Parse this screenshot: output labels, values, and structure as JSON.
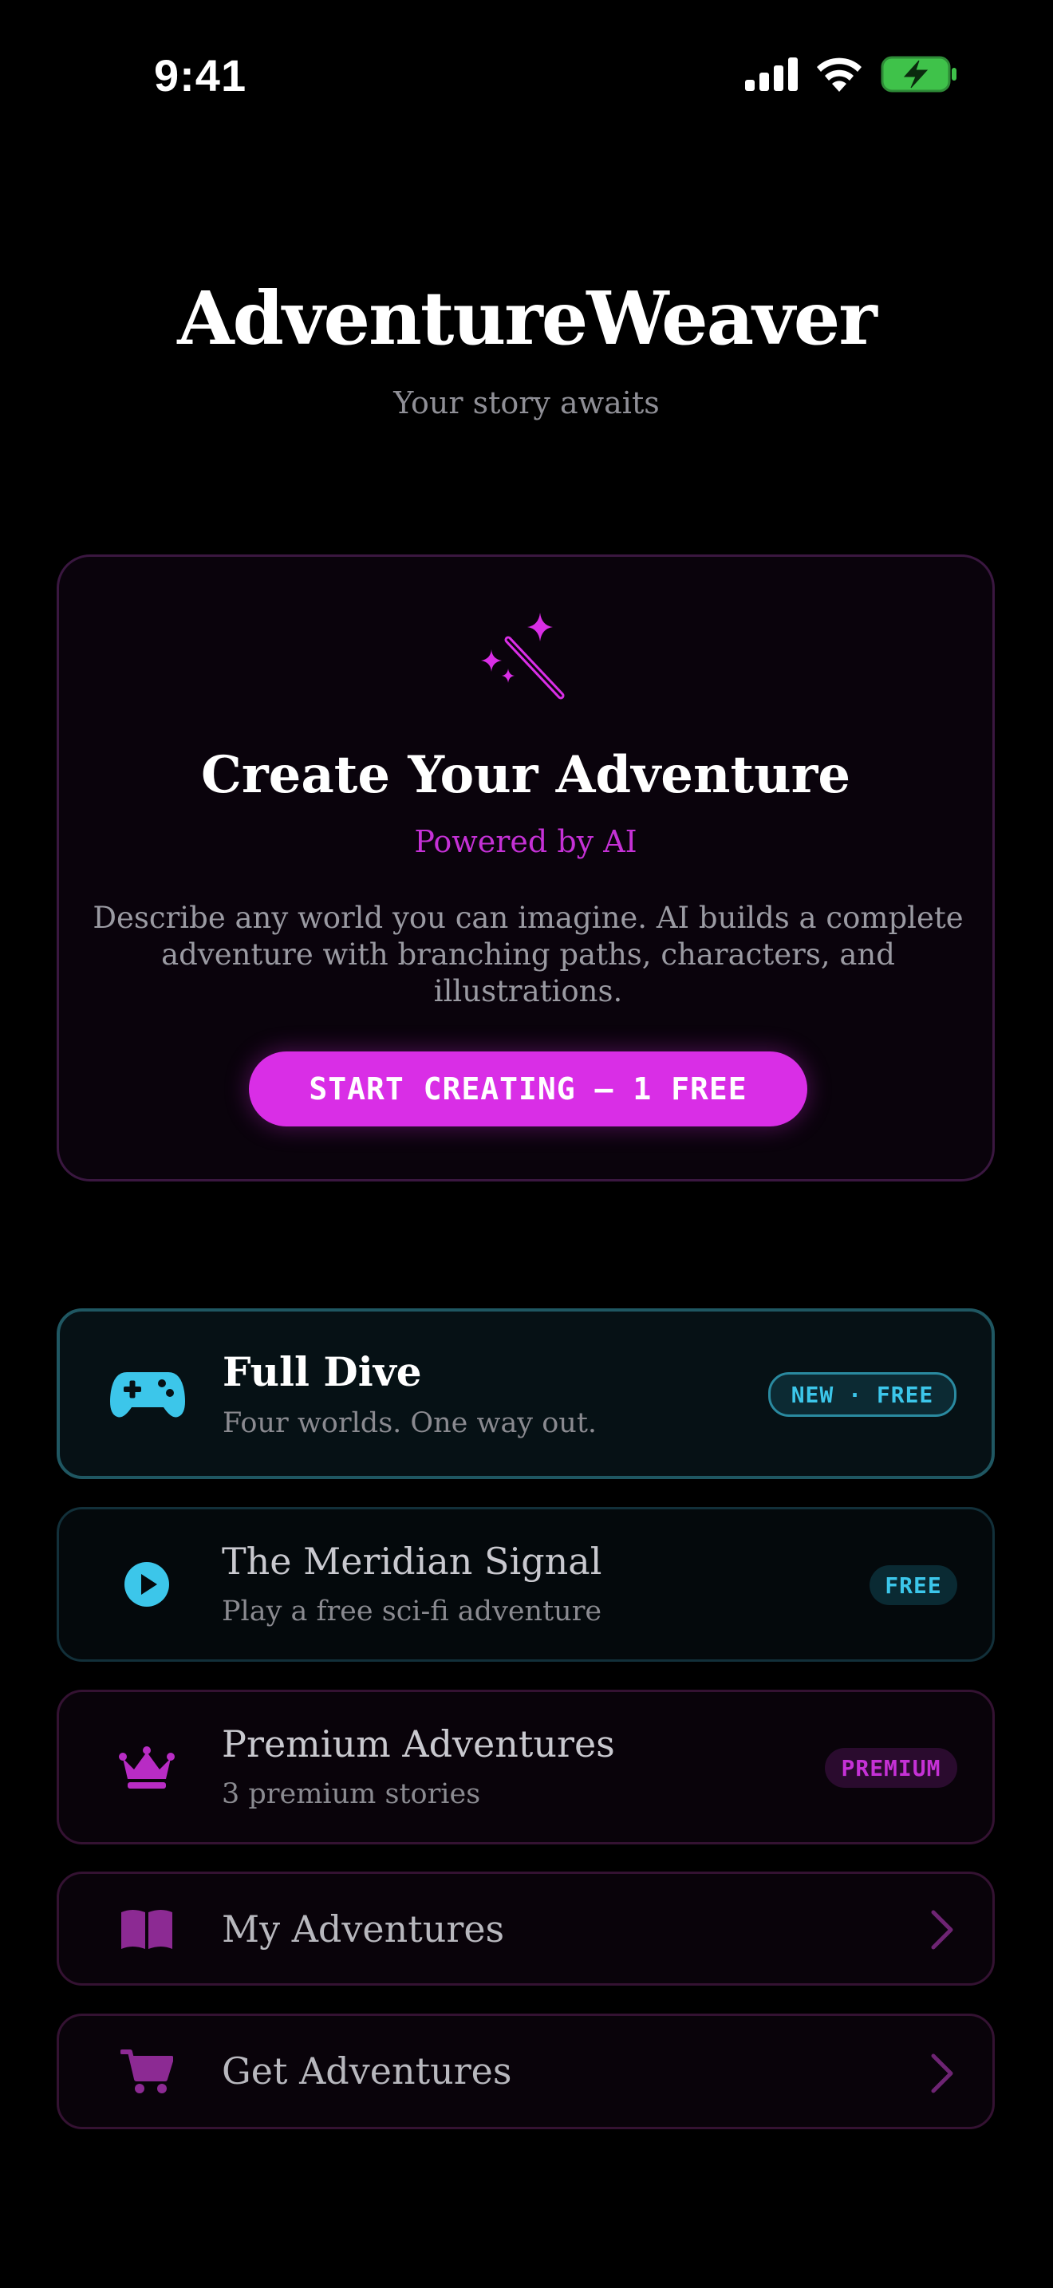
{
  "status_bar": {
    "time": "9:41",
    "icons": [
      "cellular-signal-icon",
      "wifi-icon",
      "battery-charging-icon"
    ]
  },
  "header": {
    "title": "AdventureWeaver",
    "subtitle": "Your story awaits"
  },
  "create_card": {
    "icon": "magic-wand-icon",
    "title": "Create Your Adventure",
    "powered_by": "Powered by AI",
    "description": "Describe any world you can imagine. AI builds a complete adventure with branching paths, characters, and illustrations.",
    "button_label": "START CREATING — 1 FREE"
  },
  "menu": {
    "full_dive": {
      "icon": "gamepad-icon",
      "title": "Full Dive",
      "subtitle": "Four worlds. One way out.",
      "badge": "NEW · FREE"
    },
    "meridian": {
      "icon": "play-circle-icon",
      "title": "The Meridian Signal",
      "subtitle": "Play a free sci-fi adventure",
      "badge": "FREE"
    },
    "premium": {
      "icon": "crown-icon",
      "title": "Premium Adventures",
      "subtitle": "3 premium stories",
      "badge": "PREMIUM"
    },
    "my_adventures": {
      "icon": "open-book-icon",
      "title": "My Adventures"
    },
    "get_adventures": {
      "icon": "shopping-cart-icon",
      "title": "Get Adventures"
    }
  },
  "colors": {
    "background": "#000000",
    "accent_magenta": "#d92ee6",
    "accent_cyan": "#3cc6ea",
    "muted_purple": "#8c2a93",
    "battery_green": "#3fc24a"
  }
}
